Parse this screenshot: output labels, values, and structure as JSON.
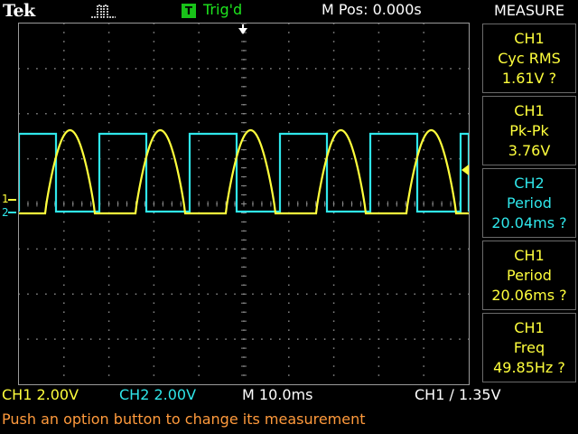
{
  "header": {
    "brand": "Tek",
    "trigger_box": "T",
    "trigger_status": "Trig'd",
    "m_pos": "M Pos: 0.000s"
  },
  "measure": {
    "title": "MEASURE",
    "items": [
      {
        "source": "CH1",
        "label": "Cyc RMS",
        "value": "1.61V ?"
      },
      {
        "source": "CH1",
        "label": "Pk-Pk",
        "value": "3.76V"
      },
      {
        "source": "CH2",
        "label": "Period",
        "value": "20.04ms ?"
      },
      {
        "source": "CH1",
        "label": "Period",
        "value": "20.06ms ?"
      },
      {
        "source": "CH1",
        "label": "Freq",
        "value": "49.85Hz ?"
      }
    ]
  },
  "markers": {
    "ch1": "1",
    "ch2": "2"
  },
  "readout": {
    "ch1": "CH1  2.00V",
    "ch2": "CH2  2.00V",
    "timebase": "M 10.0ms",
    "trigger": "CH1 ∕ 1.35V"
  },
  "message": "Push an option button to change its measurement",
  "colors": {
    "ch1": "#ffff3c",
    "ch2": "#2fe6ea",
    "trigger_green": "#1ee61e",
    "message": "#ff9a3c"
  }
}
